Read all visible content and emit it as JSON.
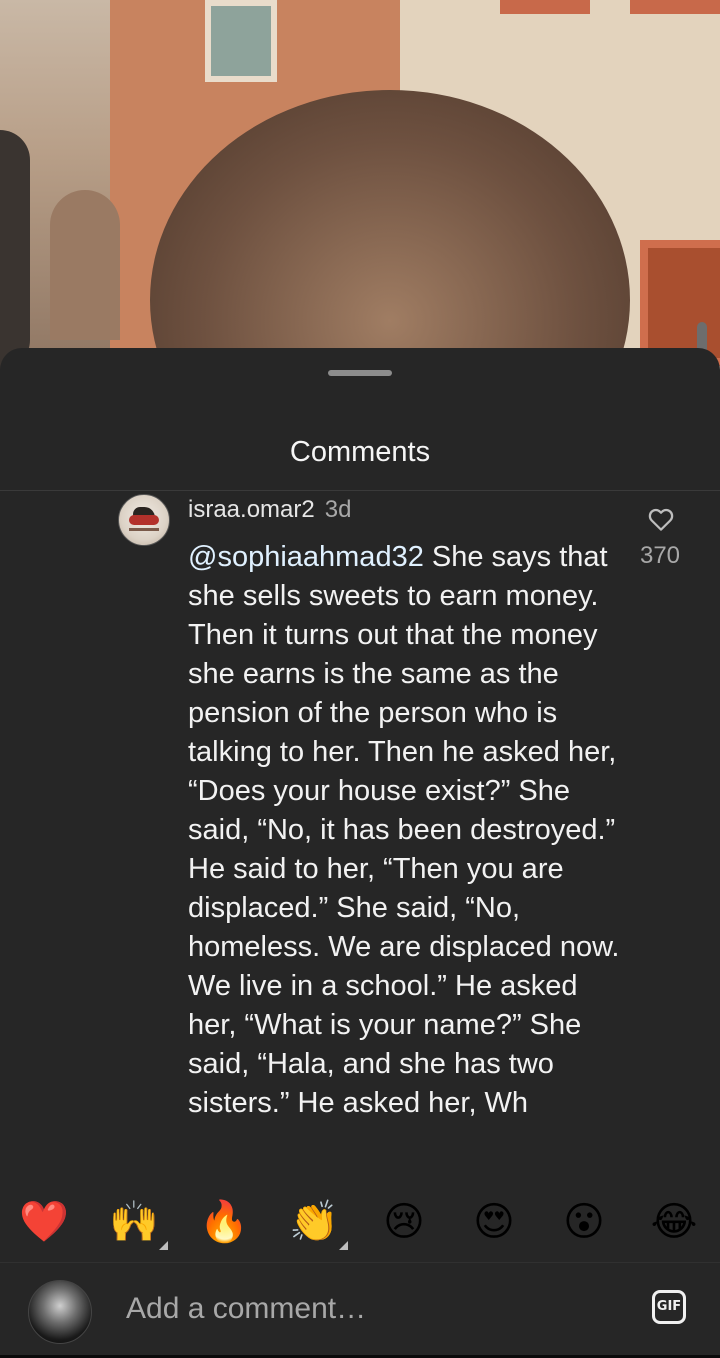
{
  "sheet": {
    "title": "Comments"
  },
  "comment": {
    "username": "israa.omar2",
    "time": "3d",
    "mention": "@sophiaahmad32",
    "text": " She says that she sells sweets to earn money. Then it turns out that the money she earns is the same as the pension of the person who is talking to her. Then he asked her, “Does your house exist?” She said, “No, it has been destroyed.” He said to her, “Then you are displaced.” She said, “No, homeless. We are displaced now. We live in a school.” He asked her, “What is your name?” She said, “Hala, and she has two sisters.” He asked her, Wh",
    "like_count": "370",
    "like_icon": "heart-outline-icon"
  },
  "emoji_bar": [
    {
      "emoji": "❤️",
      "name": "red-heart-emoji"
    },
    {
      "emoji": "🙌",
      "name": "raised-hands-emoji"
    },
    {
      "emoji": "🔥",
      "name": "fire-emoji"
    },
    {
      "emoji": "👏",
      "name": "clapping-hands-emoji"
    },
    {
      "emoji": "😢",
      "name": "crying-face-emoji"
    },
    {
      "emoji": "😍",
      "name": "heart-eyes-emoji"
    },
    {
      "emoji": "😮",
      "name": "surprised-face-emoji"
    },
    {
      "emoji": "😂",
      "name": "tears-of-joy-emoji"
    }
  ],
  "composer": {
    "placeholder": "Add a comment…",
    "gif_label": "GIF"
  },
  "colors": {
    "sheet_bg": "#262626",
    "text_primary": "#f2f2f2",
    "text_secondary": "#a8a8a8"
  }
}
